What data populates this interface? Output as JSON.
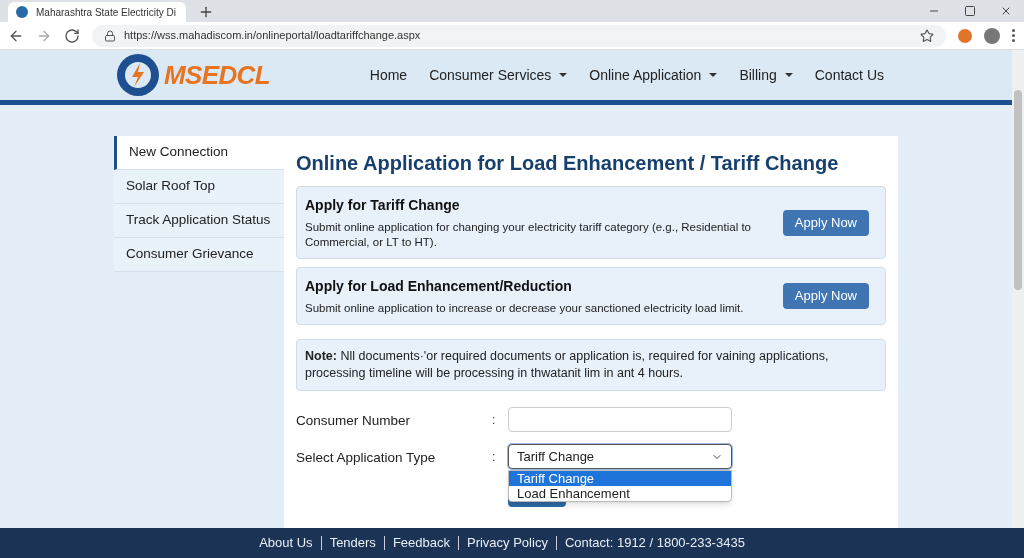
{
  "browser": {
    "tab_title": "Maharashtra State Electricity Di",
    "url": "https://wss.mahadiscom.in/onlineportal/loadtariffchange.aspx"
  },
  "header": {
    "logo_text": "MSEDCL",
    "nav": [
      {
        "label": "Home",
        "has_menu": false
      },
      {
        "label": "Consumer Services",
        "has_menu": true
      },
      {
        "label": "Online Application",
        "has_menu": true
      },
      {
        "label": "Billing",
        "has_menu": true
      },
      {
        "label": "Contact Us",
        "has_menu": false
      }
    ]
  },
  "sidebar": {
    "items": [
      {
        "label": "New Connection",
        "selected": true
      },
      {
        "label": "Solar Roof Top",
        "selected": false
      },
      {
        "label": "Track Application Status",
        "selected": false
      },
      {
        "label": "Consumer Grievance",
        "selected": false
      }
    ]
  },
  "main": {
    "heading": "Online Application for Load Enhancement / Tariff Change",
    "cards": [
      {
        "title": "Apply for Tariff Change",
        "description": "Submit online application for changing your electricity tariff category (e.g., Residential to Commercial, or LT to HT).",
        "button": "Apply Now"
      },
      {
        "title": "Apply for Load Enhancement/Reduction",
        "description": "Submit online application to increase or decrease your sanctioned electricity load limit.",
        "button": "Apply Now"
      }
    ],
    "note": "**Note:** Nll documents·'or required documents or application is, required for vaining applications, processing timeline will be processing in thwatanit lim in ant 4 hours.",
    "form": {
      "consumer_number": {
        "label": "Consumer Number",
        "separator": ":"
      },
      "application_type": {
        "label": "Select Application Type",
        "separator": ":",
        "value": "Tariff Change",
        "expanded": true,
        "options": [
          {
            "label": "Tariff Change",
            "selected": true
          },
          {
            "label": "Load Enhancement",
            "selected": false
          }
        ]
      }
    }
  },
  "footer": {
    "links": [
      "About Us",
      "Tenders",
      "Feedback",
      "Privacy Policy",
      "Contact: 1912 / 1800-233-3435"
    ]
  }
}
